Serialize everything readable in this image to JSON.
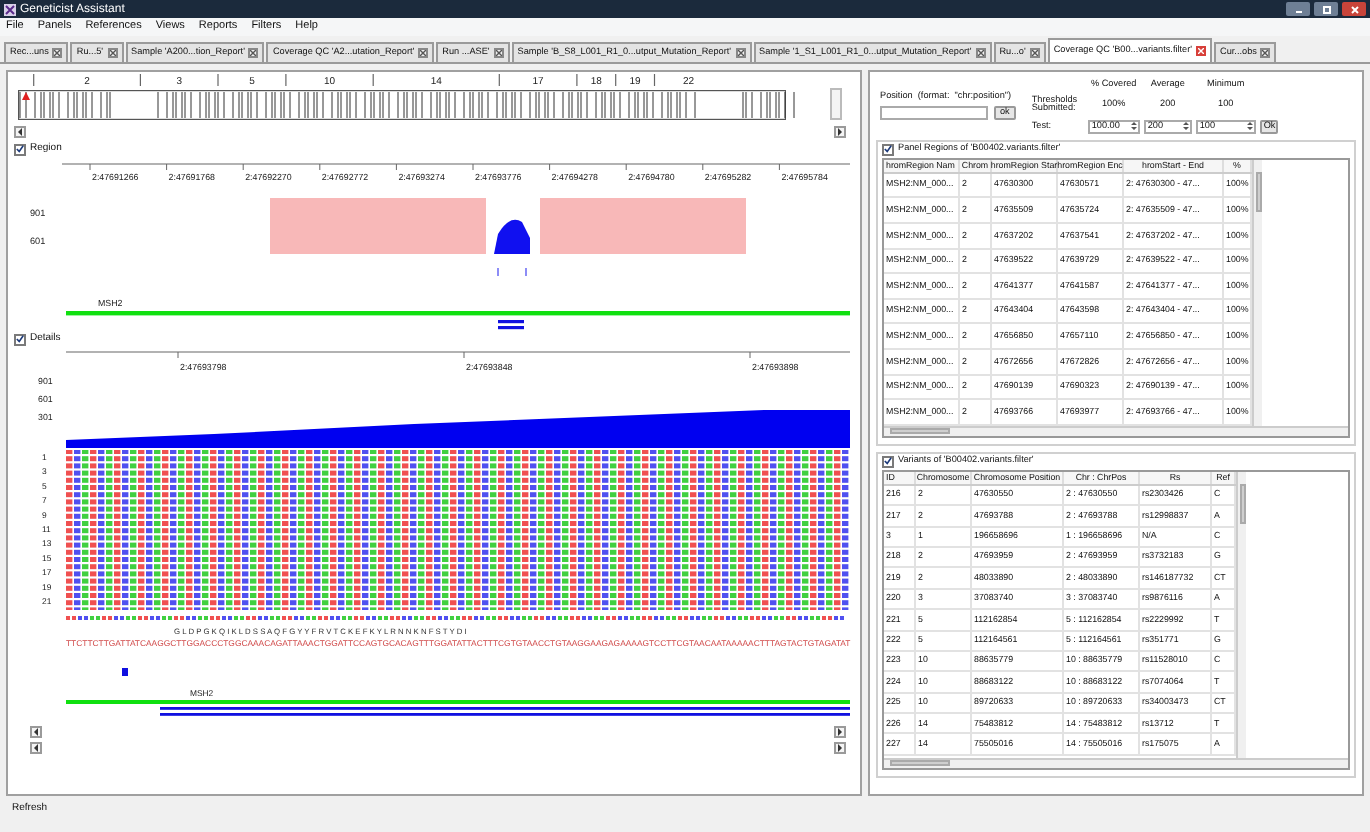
{
  "window": {
    "title": "Geneticist Assistant"
  },
  "menu": [
    "File",
    "Panels",
    "References",
    "Views",
    "Reports",
    "Filters",
    "Help"
  ],
  "tabs": [
    {
      "label": "Rec...uns",
      "selected": false
    },
    {
      "label": "Ru...5'",
      "selected": false
    },
    {
      "label": "Sample 'A200...tion_Report'",
      "selected": false
    },
    {
      "label": "Coverage QC 'A2...utation_Report'",
      "selected": false
    },
    {
      "label": "Run ...ASE'",
      "selected": false
    },
    {
      "label": "Sample 'B_S8_L001_R1_0...utput_Mutation_Report'",
      "selected": false
    },
    {
      "label": "Sample '1_S1_L001_R1_0...utput_Mutation_Report'",
      "selected": false
    },
    {
      "label": "Ru...o'",
      "selected": false
    },
    {
      "label": "Coverage QC 'B00...variants.filter'",
      "selected": true
    },
    {
      "label": "Cur...obs",
      "selected": false
    }
  ],
  "overview": {
    "chromosomes": [
      "2",
      "3",
      "5",
      "10",
      "14",
      "17",
      "18",
      "19",
      "22"
    ]
  },
  "region": {
    "label": "Region",
    "checked": true,
    "ticks": [
      "2:47691266",
      "2:47691768",
      "2:47692270",
      "2:47692772",
      "2:47693274",
      "2:47693776",
      "2:47694278",
      "2:47694780",
      "2:47695282",
      "2:47695784"
    ],
    "y_labels": [
      "901",
      "601"
    ],
    "gene": "MSH2"
  },
  "details": {
    "label": "Details",
    "checked": true,
    "ticks": [
      "2:47693798",
      "2:47693848",
      "2:47693898"
    ],
    "y_labels": [
      "901",
      "601",
      "301"
    ],
    "read_labels": [
      "1",
      "3",
      "5",
      "7",
      "9",
      "11",
      "13",
      "15",
      "17",
      "19",
      "21"
    ],
    "amino_acids": "G L D P G K Q I K L D S S A Q F G Y Y F R V T C K E F K Y L R N N K N F S T Y D I",
    "sequence": "TTCTTCTTGATTATCAAGGCTTGGACCCTGGCAAACAGATTAAACTGGATTCCAGTGCACAGTTTGGATATTACTTTCGTGTAACCTGTAAGGAAGAGAAAAGTCCTTCGTAACAATAAAAACTTTAGTACTGTAGATAT",
    "gene": "MSH2"
  },
  "position": {
    "label": "Position  (format:  \"chr:position\")",
    "button": "ok"
  },
  "thresholds": {
    "headers": [
      "% Covered",
      "Average",
      "Minimum"
    ],
    "submitted_label": "Thresholds Submitted:",
    "submitted": [
      "100%",
      "200",
      "100"
    ],
    "test_label": "Test:",
    "test": [
      "100.00",
      "200",
      "100"
    ],
    "button": "Ok"
  },
  "panel_regions": {
    "label": "Panel Regions of 'B00402.variants.filter'",
    "checked": true,
    "columns": [
      "hromRegion Nam",
      "Chrom",
      "hromRegion Star",
      "hromRegion Enc",
      "hromStart - End",
      "%"
    ],
    "rows": [
      [
        "MSH2:NM_000...",
        "2",
        "47630300",
        "47630571",
        "2: 47630300 - 47...",
        "100%"
      ],
      [
        "MSH2:NM_000...",
        "2",
        "47635509",
        "47635724",
        "2: 47635509 - 47...",
        "100%"
      ],
      [
        "MSH2:NM_000...",
        "2",
        "47637202",
        "47637541",
        "2: 47637202 - 47...",
        "100%"
      ],
      [
        "MSH2:NM_000...",
        "2",
        "47639522",
        "47639729",
        "2: 47639522 - 47...",
        "100%"
      ],
      [
        "MSH2:NM_000...",
        "2",
        "47641377",
        "47641587",
        "2: 47641377 - 47...",
        "100%"
      ],
      [
        "MSH2:NM_000...",
        "2",
        "47643404",
        "47643598",
        "2: 47643404 - 47...",
        "100%"
      ],
      [
        "MSH2:NM_000...",
        "2",
        "47656850",
        "47657110",
        "2: 47656850 - 47...",
        "100%"
      ],
      [
        "MSH2:NM_000...",
        "2",
        "47672656",
        "47672826",
        "2: 47672656 - 47...",
        "100%"
      ],
      [
        "MSH2:NM_000...",
        "2",
        "47690139",
        "47690323",
        "2: 47690139 - 47...",
        "100%"
      ],
      [
        "MSH2:NM_000...",
        "2",
        "47693766",
        "47693977",
        "2: 47693766 - 47...",
        "100%"
      ]
    ]
  },
  "variants": {
    "label": "Variants of 'B00402.variants.filter'",
    "checked": true,
    "columns": [
      "ID",
      "Chromosome",
      "Chromosome Position",
      "Chr : ChrPos",
      "Rs",
      "Ref"
    ],
    "rows": [
      [
        "216",
        "2",
        "47630550",
        "2 : 47630550",
        "rs2303426",
        "C"
      ],
      [
        "217",
        "2",
        "47693788",
        "2 : 47693788",
        "rs12998837",
        "A"
      ],
      [
        "3",
        "1",
        "196658696",
        "1 : 196658696",
        "N/A",
        "C"
      ],
      [
        "218",
        "2",
        "47693959",
        "2 : 47693959",
        "rs3732183",
        "G"
      ],
      [
        "219",
        "2",
        "48033890",
        "2 : 48033890",
        "rs146187732",
        "CT"
      ],
      [
        "220",
        "3",
        "37083740",
        "3 : 37083740",
        "rs9876116",
        "A"
      ],
      [
        "221",
        "5",
        "112162854",
        "5 : 112162854",
        "rs2229992",
        "T"
      ],
      [
        "222",
        "5",
        "112164561",
        "5 : 112164561",
        "rs351771",
        "G"
      ],
      [
        "223",
        "10",
        "88635779",
        "10 : 88635779",
        "rs11528010",
        "C"
      ],
      [
        "224",
        "10",
        "88683122",
        "10 : 88683122",
        "rs7074064",
        "T"
      ],
      [
        "225",
        "10",
        "89720633",
        "10 : 89720633",
        "rs34003473",
        "CT"
      ],
      [
        "226",
        "14",
        "75483812",
        "14 : 75483812",
        "rs13712",
        "T"
      ],
      [
        "227",
        "14",
        "75505016",
        "14 : 75505016",
        "rs175075",
        "A"
      ]
    ]
  },
  "status_bar": {
    "text": "Refresh"
  }
}
